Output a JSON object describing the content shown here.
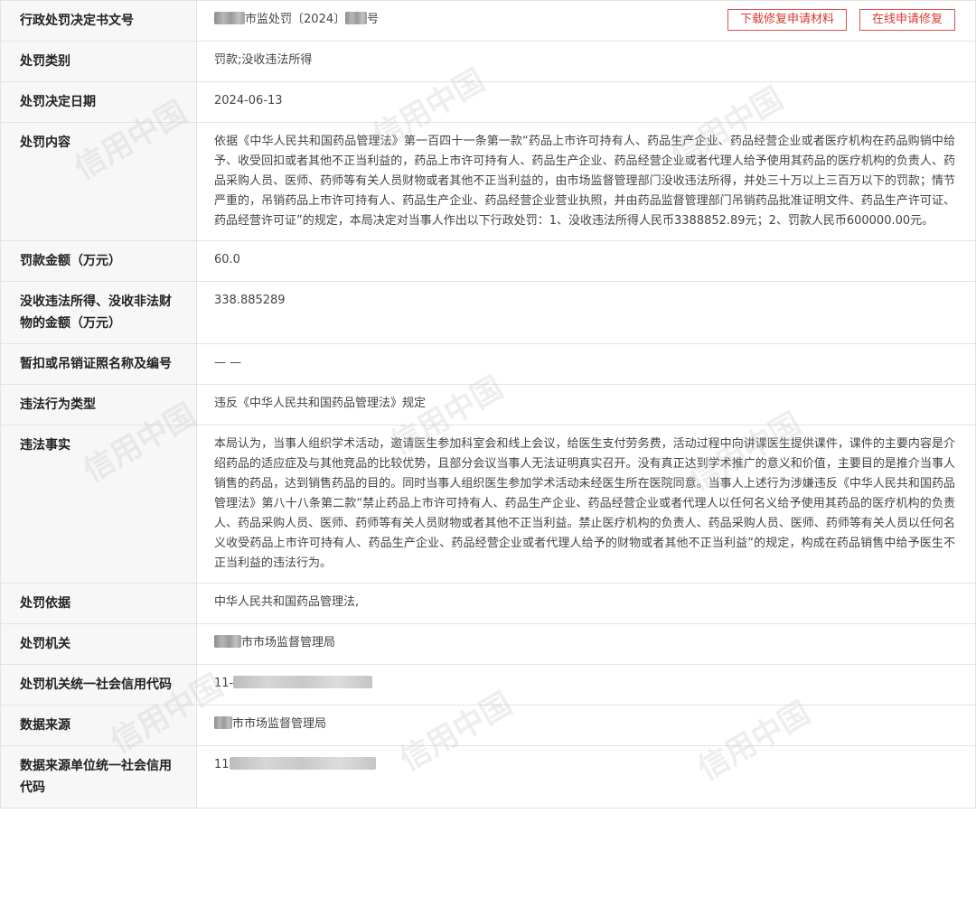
{
  "header": {
    "doc_number_label": "行政处罚决定书文号",
    "doc_number_part1": "市监处罚",
    "doc_number_paren_open": "〔",
    "doc_number_year": "2024",
    "doc_number_paren_close": "〕",
    "doc_number_suffix": "号",
    "download_button": "下载修复申请材料",
    "online_repair_button": "在线申请修复"
  },
  "rows": {
    "category": {
      "label": "处罚类别",
      "value": "罚款;没收违法所得"
    },
    "decision_date": {
      "label": "处罚决定日期",
      "value": "2024-06-13"
    },
    "content": {
      "label": "处罚内容",
      "value": "依据《中华人民共和国药品管理法》第一百四十一条第一款“药品上市许可持有人、药品生产企业、药品经营企业或者医疗机构在药品购销中给予、收受回扣或者其他不正当利益的，药品上市许可持有人、药品生产企业、药品经营企业或者代理人给予使用其药品的医疗机构的负责人、药品采购人员、医师、药师等有关人员财物或者其他不正当利益的，由市场监督管理部门没收违法所得，并处三十万以上三百万以下的罚款；情节严重的，吊销药品上市许可持有人、药品生产企业、药品经营企业营业执照，并由药品监督管理部门吊销药品批准证明文件、药品生产许可证、药品经营许可证”的规定，本局决定对当事人作出以下行政处罚：1、没收违法所得人民币3388852.89元；2、罚款人民币600000.00元。"
    },
    "fine_amount": {
      "label": "罚款金额（万元）",
      "value": "60.0"
    },
    "confiscated_amount": {
      "label": "没收违法所得、没收非法财物的金额（万元）",
      "value": "338.885289"
    },
    "license": {
      "label": "暂扣或吊销证照名称及编号",
      "value": "— —"
    },
    "violation_type": {
      "label": "违法行为类型",
      "value": "违反《中华人民共和国药品管理法》规定"
    },
    "violation_facts": {
      "label": "违法事实",
      "value": "本局认为，当事人组织学术活动，邀请医生参加科室会和线上会议，给医生支付劳务费，活动过程中向讲课医生提供课件，课件的主要内容是介绍药品的适应症及与其他竞品的比较优势，且部分会议当事人无法证明真实召开。没有真正达到学术推广的意义和价值，主要目的是推介当事人销售的药品，达到销售药品的目的。同时当事人组织医生参加学术活动未经医生所在医院同意。当事人上述行为涉嫌违反《中华人民共和国药品管理法》第八十八条第二款“禁止药品上市许可持有人、药品生产企业、药品经营企业或者代理人以任何名义给予使用其药品的医疗机构的负责人、药品采购人员、医师、药师等有关人员财物或者其他不正当利益。禁止医疗机构的负责人、药品采购人员、医师、药师等有关人员以任何名义收受药品上市许可持有人、药品生产企业、药品经营企业或者代理人给予的财物或者其他不正当利益”的规定，构成在药品销售中给予医生不正当利益的违法行为。"
    },
    "basis": {
      "label": "处罚依据",
      "value": "中华人民共和国药品管理法,"
    },
    "authority": {
      "label": "处罚机关",
      "value": "市市场监督管理局"
    },
    "authority_credit_code": {
      "label": "处罚机关统一社会信用代码",
      "value_prefix": "11-"
    },
    "data_source": {
      "label": "数据来源",
      "value": "市市场监督管理局"
    },
    "source_credit_code": {
      "label": "数据来源单位统一社会信用代码",
      "value_prefix": "11"
    }
  },
  "watermark": {
    "text": "信用中国",
    "color": "#c4c4c4"
  },
  "colors": {
    "accent_red": "#d93a33",
    "label_bg": "#f7f7f7",
    "border": "#e3e3e3"
  }
}
